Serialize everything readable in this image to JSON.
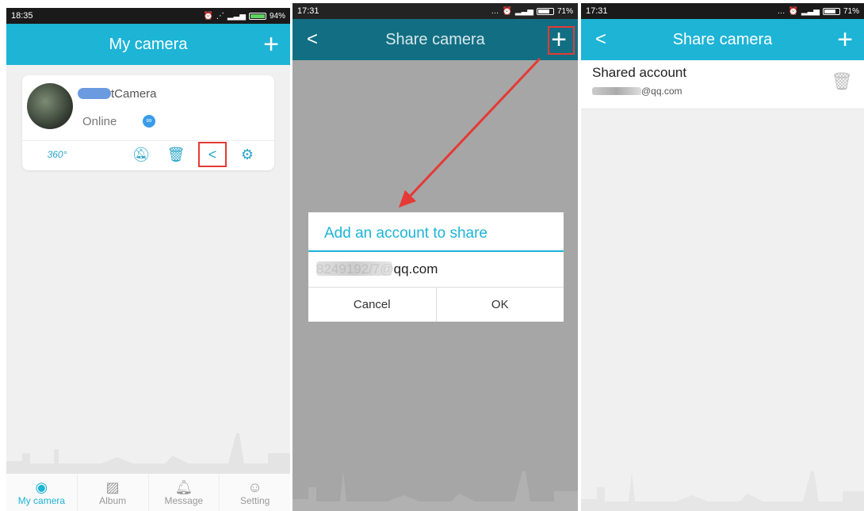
{
  "panel1": {
    "status_time": "18:35",
    "status_battery": "94%",
    "title": "My camera",
    "plus": "+",
    "camera": {
      "name_suffix": "tCamera",
      "status": "Online"
    },
    "actions": {
      "view360": "360",
      "mute_icon": "bell-off-icon",
      "delete_icon": "trash-icon",
      "share_icon": "share-icon",
      "settings_icon": "gear-icon"
    },
    "tabs": [
      {
        "label": "My camera",
        "icon": "camera-icon"
      },
      {
        "label": "Album",
        "icon": "image-icon"
      },
      {
        "label": "Message",
        "icon": "bell-icon"
      },
      {
        "label": "Setting",
        "icon": "person-icon"
      }
    ]
  },
  "panel2": {
    "status_time": "17:31",
    "status_battery": "71%",
    "title": "Share camera",
    "back": "<",
    "plus": "+",
    "dialog": {
      "title": "Add an account to share",
      "input_value": "8249192/7@qq.com",
      "cancel": "Cancel",
      "ok": "OK"
    }
  },
  "panel3": {
    "status_time": "17:31",
    "status_battery": "71%",
    "title": "Share camera",
    "back": "<",
    "plus": "+",
    "shared_title": "Shared account",
    "shared_email": "@qq.com"
  },
  "colors": {
    "teal": "#1db4d6",
    "highlight": "#e53935"
  }
}
